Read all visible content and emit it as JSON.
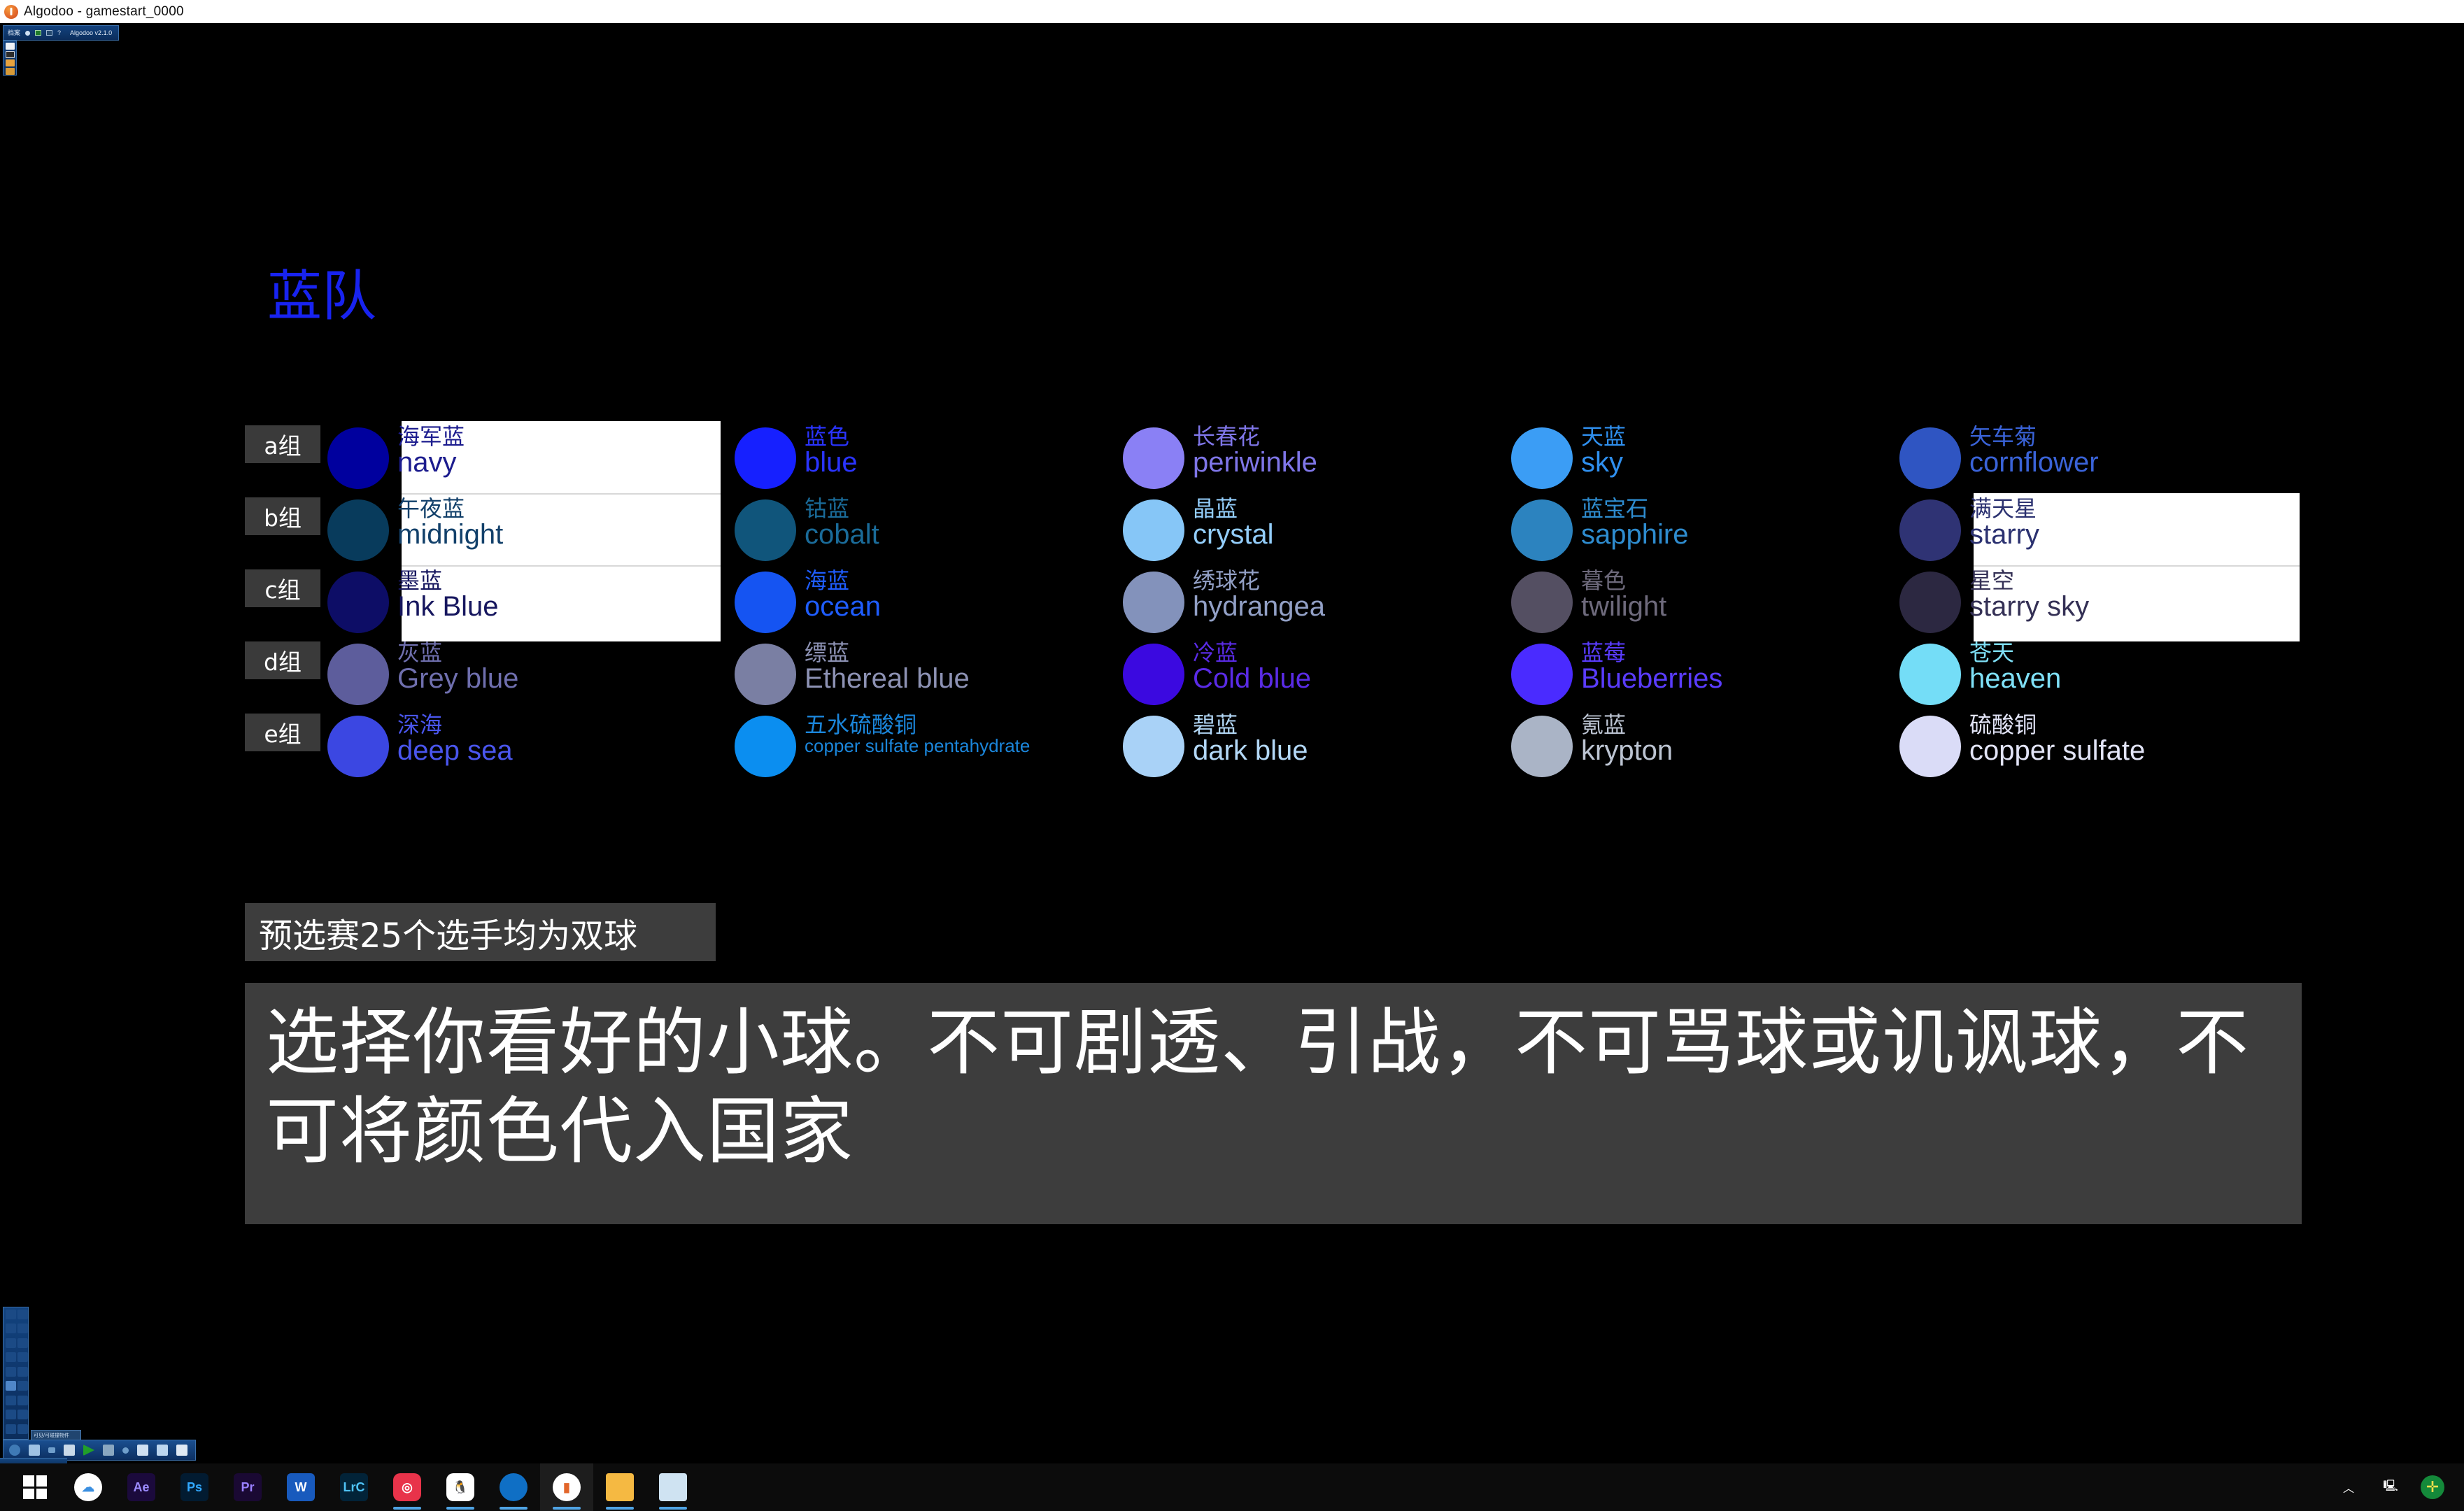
{
  "window": {
    "title": "Algodoo - gamestart_0000",
    "app_icon": "algodoo-icon"
  },
  "algodoo_menu": {
    "file_label": "档案",
    "version_label": "Algodoo v2.1.0",
    "items": [
      "档案",
      "scene-dot",
      "play-button",
      "window-button",
      "help-question"
    ]
  },
  "scene": {
    "title": "蓝队",
    "title_color": "#1823f0",
    "group_labels": [
      "a组",
      "b组",
      "c组",
      "d组",
      "e组"
    ],
    "columns": [
      {
        "name": "column-1",
        "entries": [
          {
            "cn": "海军蓝",
            "en": "navy",
            "ball": "#00009e",
            "text": "#1c1c8e",
            "en_size": "lg",
            "highlighted": true
          },
          {
            "cn": "午夜蓝",
            "en": "midnight",
            "ball": "#083b5c",
            "text": "#12406a",
            "en_size": "lg",
            "highlighted": true
          },
          {
            "cn": "墨蓝",
            "en": "Ink Blue",
            "ball": "#0d0d66",
            "text": "#16165e",
            "en_size": "lg",
            "highlighted": true
          },
          {
            "cn": "灰蓝",
            "en": "Grey blue",
            "ball": "#5d5d9c",
            "text": "#6f6fae",
            "en_size": "lg",
            "highlighted": false
          },
          {
            "cn": "深海",
            "en": "deep sea",
            "ball": "#3b47e2",
            "text": "#4a56ee",
            "en_size": "lg",
            "highlighted": false
          }
        ]
      },
      {
        "name": "column-2",
        "entries": [
          {
            "cn": "蓝色",
            "en": "blue",
            "ball": "#1620ff",
            "text": "#2a34ff",
            "en_size": "lg",
            "highlighted": false
          },
          {
            "cn": "钴蓝",
            "en": "cobalt",
            "ball": "#10557b",
            "text": "#1a6b99",
            "en_size": "lg",
            "highlighted": false
          },
          {
            "cn": "海蓝",
            "en": "ocean",
            "ball": "#1554f2",
            "text": "#1f5dff",
            "en_size": "lg",
            "highlighted": false
          },
          {
            "cn": "缥蓝",
            "en": "Ethereal blue",
            "ball": "#7a7fa3",
            "text": "#8d92b4",
            "en_size": "lg",
            "highlighted": false
          },
          {
            "cn": "五水硫酸铜",
            "en": "copper sulfate pentahydrate",
            "ball": "#0b8ef0",
            "text": "#1b86db",
            "en_size": "sm",
            "highlighted": false
          }
        ]
      },
      {
        "name": "column-3",
        "entries": [
          {
            "cn": "长春花",
            "en": "periwinkle",
            "ball": "#8a80f5",
            "text": "#7f76e8",
            "en_size": "lg",
            "highlighted": false
          },
          {
            "cn": "晶蓝",
            "en": "crystal",
            "ball": "#86c6f7",
            "text": "#93cdfa",
            "en_size": "lg",
            "highlighted": false
          },
          {
            "cn": "绣球花",
            "en": "hydrangea",
            "ball": "#8392bb",
            "text": "#92a0c6",
            "en_size": "lg",
            "highlighted": false
          },
          {
            "cn": "冷蓝",
            "en": "Cold blue",
            "ball": "#3b09e0",
            "text": "#5a2be6",
            "en_size": "lg",
            "highlighted": false
          },
          {
            "cn": "碧蓝",
            "en": "dark blue",
            "ball": "#a9d2f7",
            "text": "#b3d8f7",
            "en_size": "lg",
            "highlighted": false
          }
        ]
      },
      {
        "name": "column-4",
        "entries": [
          {
            "cn": "天蓝",
            "en": "sky",
            "ball": "#3b9df5",
            "text": "#2f8fee",
            "en_size": "lg",
            "highlighted": false
          },
          {
            "cn": "蓝宝石",
            "en": "sapphire",
            "ball": "#2c83bf",
            "text": "#2e8ccf",
            "en_size": "lg",
            "highlighted": false
          },
          {
            "cn": "暮色",
            "en": "twilight",
            "ball": "#544f62",
            "text": "#6e6a7c",
            "en_size": "lg",
            "highlighted": false
          },
          {
            "cn": "蓝莓",
            "en": "Blueberries",
            "ball": "#4a2bff",
            "text": "#5a3cff",
            "en_size": "lg",
            "highlighted": false
          },
          {
            "cn": "氪蓝",
            "en": "krypton",
            "ball": "#aab4c6",
            "text": "#bcc4d2",
            "en_size": "lg",
            "highlighted": false
          }
        ]
      },
      {
        "name": "column-5",
        "entries": [
          {
            "cn": "矢车菊",
            "en": "cornflower",
            "ball": "#2f55c2",
            "text": "#3a63d8",
            "en_size": "lg",
            "highlighted": false
          },
          {
            "cn": "满天星",
            "en": "starry",
            "ball": "#2f3374",
            "text": "#2b3170",
            "en_size": "lg",
            "highlighted": true
          },
          {
            "cn": "星空",
            "en": "starry sky",
            "ball": "#2c2841",
            "text": "#343055",
            "en_size": "lg",
            "highlighted": true
          },
          {
            "cn": "苍天",
            "en": "heaven",
            "ball": "#74ddf7",
            "text": "#7fe0f7",
            "en_size": "lg",
            "highlighted": false
          },
          {
            "cn": "硫酸铜",
            "en": "copper sulfate",
            "ball": "#dadcf7",
            "text": "#e2e4f7",
            "en_size": "lg",
            "highlighted": false
          }
        ]
      }
    ],
    "small_note": "预选赛25个选手均为双球",
    "big_note": "选择你看好的小球。不可剧透、引战，不可骂球或讥讽球，不可将颜色代入国家"
  },
  "algodoo_bottom_tip": "可见/可碰撞物件",
  "taskbar": {
    "start_label": "start-button",
    "items": [
      {
        "name": "baidu-netdisk",
        "label": "",
        "bg": "#ffffff",
        "fg": "#3b8fe0"
      },
      {
        "name": "after-effects",
        "label": "Ae",
        "bg": "#1b0a3c",
        "fg": "#9d8cff"
      },
      {
        "name": "photoshop",
        "label": "Ps",
        "bg": "#021b31",
        "fg": "#31a8ff"
      },
      {
        "name": "premiere-pro",
        "label": "Pr",
        "bg": "#1a0933",
        "fg": "#9a80ff"
      },
      {
        "name": "word",
        "label": "W",
        "bg": "#185abd",
        "fg": "#ffffff"
      },
      {
        "name": "lightroom-classic",
        "label": "LrC",
        "bg": "#022338",
        "fg": "#4fc3f7"
      },
      {
        "name": "netease-music",
        "label": "",
        "bg": "#e8334a",
        "fg": "#ffffff"
      },
      {
        "name": "qq",
        "label": "",
        "bg": "#ffffff",
        "fg": "#111111"
      },
      {
        "name": "microsoft-edge",
        "label": "",
        "bg": "#0f6fc5",
        "fg": "#ffffff"
      },
      {
        "name": "algodoo",
        "label": "",
        "bg": "#ffffff",
        "fg": "#e2662a"
      },
      {
        "name": "file-explorer",
        "label": "",
        "bg": "#f5b942",
        "fg": "#ffffff"
      },
      {
        "name": "sticky-notes",
        "label": "",
        "bg": "#cfe3f2",
        "fg": "#ffffff"
      }
    ],
    "tray": [
      "chevron-up-icon",
      "network-icon",
      "security-icon"
    ]
  }
}
